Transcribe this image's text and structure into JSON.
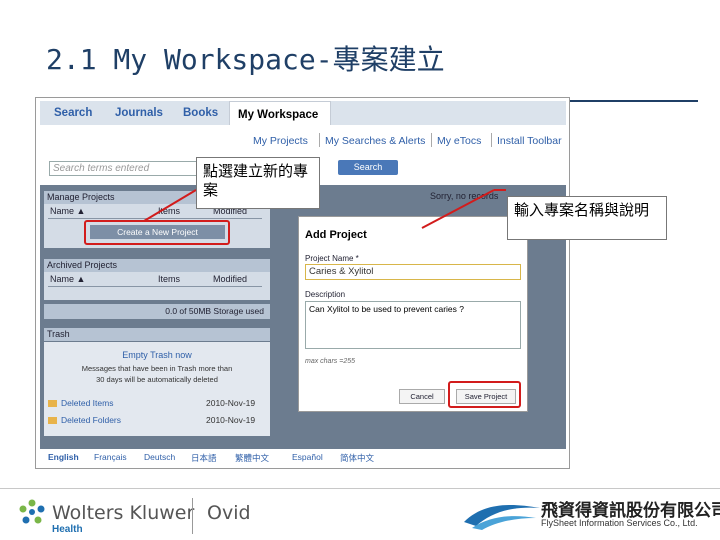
{
  "slide": {
    "title": "2.1 My Workspace-專案建立"
  },
  "app": {
    "nav": {
      "tabs": [
        "Search",
        "Journals",
        "Books"
      ],
      "active_tab": "My Workspace"
    },
    "subnav": [
      "My Projects",
      "My Searches & Alerts",
      "My eTocs",
      "Install Toolbar"
    ],
    "search": {
      "placeholder": "Search terms entered",
      "button": "Search"
    },
    "manage_projects": {
      "header": "Manage Projects",
      "col_name": "Name ▲",
      "col_items": "Items",
      "col_modified": "Modified",
      "create_button": "Create a New Project"
    },
    "archived_projects": {
      "header": "Archived Projects",
      "col_name": "Name ▲",
      "col_items": "Items",
      "col_modified": "Modified"
    },
    "storage": "0.0 of 50MB Storage used",
    "trash": {
      "header": "Trash",
      "empty_link": "Empty Trash now",
      "note_1": "Messages that have been in Trash more than",
      "note_2": "30 days will be automatically deleted",
      "rows": [
        {
          "label": "Deleted Items",
          "date": "2010-Nov-19"
        },
        {
          "label": "Deleted Folders",
          "date": "2010-Nov-19"
        }
      ]
    },
    "sorry_text": "Sorry, no records",
    "languages": [
      "English",
      "Français",
      "Deutsch",
      "日本語",
      "繁體中文",
      "Español",
      "简体中文"
    ]
  },
  "dialog": {
    "title": "Add Project",
    "close": "X",
    "name_label": "Project Name *",
    "name_value": "Caries & Xylitol",
    "desc_label": "Description",
    "desc_value": "Can Xylitol to be  used to prevent caries ?",
    "max_chars": "max chars =255",
    "cancel": "Cancel",
    "save": "Save Project"
  },
  "callouts": {
    "left": "點選建立新的專案",
    "right": "輸入專案名稱與說明"
  },
  "footer": {
    "wk_name": "Wolters Kluwer",
    "wk_health": "Health",
    "ovid": "Ovid",
    "fs_name_cn": "飛資得資訊股份有限公司",
    "fs_name_en": "FlySheet Information Services Co., Ltd."
  },
  "colors": {
    "title": "#1f3f66",
    "highlight": "#d21c1c",
    "link": "#2f5fa8"
  }
}
